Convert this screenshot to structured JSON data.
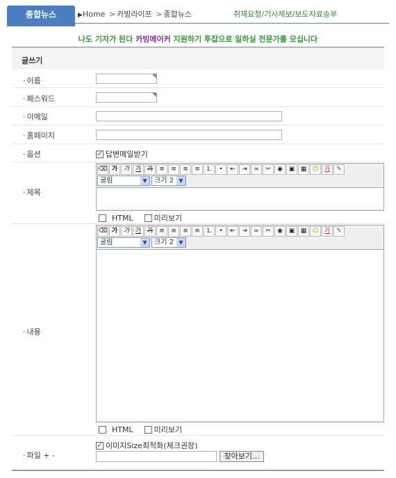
{
  "header": {
    "tab_label": "종합뉴스",
    "breadcrumb": [
      "Home",
      "카빙라이프",
      "종합뉴스"
    ],
    "links": "취재요청/기사제보/보도자료송부"
  },
  "banner": {
    "part1": "나도 기자가 된다 ",
    "part2": "카빙메이커",
    "part3": " 지원하기 투잡으로 일하실 전문가를 모십니다"
  },
  "form": {
    "title": "글쓰기",
    "name_label": "이름",
    "password_label": "패스워드",
    "email_label": "이메일",
    "homepage_label": "홈페이지",
    "option_label": "옵션",
    "option_checkbox": "답변메일받기",
    "subject_label": "제목",
    "content_label": "내용",
    "file_label": "파일 + -",
    "font_select": "굴림",
    "size_select": "크기 2",
    "html_checkbox": "HTML",
    "preview_checkbox": "미리보기",
    "image_optimize": "이미지Size최적화(체크권장)",
    "browse_button": "찾아보기..."
  },
  "toolbar": {
    "buttons": [
      "eraser-icon",
      "bold-icon",
      "italic-icon",
      "underline-icon",
      "strike-icon",
      "align-left-icon",
      "align-center-icon",
      "align-right-icon",
      "justify-icon",
      "ordered-list-icon",
      "unordered-list-icon",
      "outdent-icon",
      "indent-icon",
      "link-icon",
      "unlink-icon",
      "flash-icon",
      "image-icon",
      "table-icon",
      "emoticon-icon",
      "font-color-icon",
      "highlight-icon"
    ],
    "glyphs": [
      "⌫",
      "가",
      "가",
      "가",
      "가",
      "≡",
      "≡",
      "≡",
      "≡",
      "⒈",
      "•",
      "⇤",
      "⇥",
      "∞",
      "✂",
      "◉",
      "▣",
      "▦",
      "☺",
      "가",
      "✎"
    ]
  }
}
